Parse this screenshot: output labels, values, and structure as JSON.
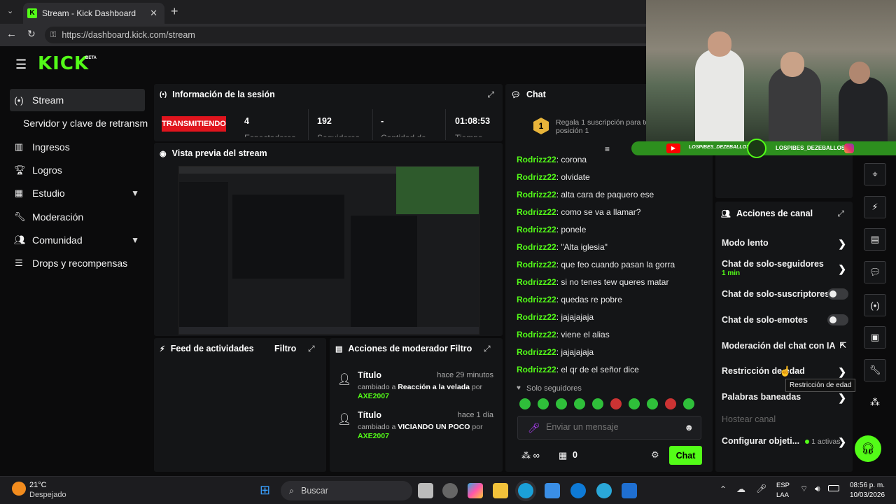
{
  "browser": {
    "tab_title": "Stream - Kick Dashboard",
    "new_tab": "+",
    "url": "https://dashboard.kick.com/stream"
  },
  "logo": {
    "text": "KICK",
    "beta": "BETA"
  },
  "sidebar": {
    "items": [
      {
        "label": "Stream",
        "icon": "broadcast-icon"
      },
      {
        "label": "Servidor y clave de retransm",
        "icon": ""
      },
      {
        "label": "Ingresos",
        "icon": "chart-icon"
      },
      {
        "label": "Logros",
        "icon": "trophy-icon"
      },
      {
        "label": "Estudio",
        "icon": "grid-icon"
      },
      {
        "label": "Moderación",
        "icon": "wrench-icon"
      },
      {
        "label": "Comunidad",
        "icon": "people-icon"
      },
      {
        "label": "Drops y recompensas",
        "icon": "list-icon"
      }
    ]
  },
  "session": {
    "title": "Información de la sesión",
    "status": "TRANSMITIENDO",
    "spectators": "4",
    "spectators_label": "Espectadores",
    "followers": "192",
    "followers_label": "Seguidores",
    "quantity": "-",
    "quantity_label": "Cantidad de",
    "time": "01:08:53",
    "time_label": "Tiempo"
  },
  "preview": {
    "title": "Vista previa del stream"
  },
  "feed": {
    "title": "Feed de actividades",
    "filter": "Filtro"
  },
  "modactions": {
    "title": "Acciones de moderador",
    "filter": "Filtro",
    "entries": [
      {
        "title": "Título",
        "time": "hace 29 minutos",
        "changed": "cambiado a",
        "value": "Reacción a la velada",
        "by": "por",
        "user": "AXE2007"
      },
      {
        "title": "Título",
        "time": "hace 1 día",
        "changed": "cambiado a",
        "value": "VICIANDO UN POCO",
        "by": "por",
        "user": "AXE2007"
      }
    ]
  },
  "chat": {
    "title": "Chat",
    "gift_rank": "1",
    "gift_text": "Regala 1 suscripción para te",
    "gift_text2": "posición 1",
    "messages": [
      {
        "user": "Rodrizz22",
        "text": ": corona"
      },
      {
        "user": "Rodrizz22",
        "text": ": olvidate"
      },
      {
        "user": "Rodrizz22",
        "text": ": alta cara de paquero ese"
      },
      {
        "user": "Rodrizz22",
        "text": ": como se va a llamar?"
      },
      {
        "user": "Rodrizz22",
        "text": ": ponele"
      },
      {
        "user": "Rodrizz22",
        "text": ": \"Alta iglesia\""
      },
      {
        "user": "Rodrizz22",
        "text": ": que feo cuando pasan la gorra"
      },
      {
        "user": "Rodrizz22",
        "text": ": si no tenes tew queres matar"
      },
      {
        "user": "Rodrizz22",
        "text": ": quedas re pobre"
      },
      {
        "user": "Rodrizz22",
        "text": ": jajajajaja"
      },
      {
        "user": "Rodrizz22",
        "text": ": viene el alias"
      },
      {
        "user": "Rodrizz22",
        "text": ": jajajajaja"
      },
      {
        "user": "Rodrizz22",
        "text": ": el qr de el señor dice"
      }
    ],
    "followers_only": "Solo seguidores",
    "placeholder": "Enviar un mensaje",
    "viewer_count": "0",
    "send": "Chat"
  },
  "overlay": {
    "youtube": "LOSPIBES_DEZEBALLOS",
    "instagram": "LOSPIBES_DEZEBALLOS"
  },
  "channel_actions": {
    "title": "Acciones de canal",
    "items": [
      {
        "label": "Modo lento",
        "type": "chevron"
      },
      {
        "label": "Chat de solo-seguidores",
        "sub": "1 min",
        "type": "chevron"
      },
      {
        "label": "Chat de solo-suscriptores",
        "type": "toggle"
      },
      {
        "label": "Chat de solo-emotes",
        "type": "toggle"
      },
      {
        "label": "Moderación del chat con IA",
        "type": "external"
      },
      {
        "label": "Restricción de edad",
        "type": "chevron"
      },
      {
        "label": "Palabras baneadas",
        "type": "chevron"
      },
      {
        "label": "Hostear canal",
        "type": "disabled"
      },
      {
        "label": "Configurar objeti...",
        "sub": "1 activas",
        "type": "chevron"
      }
    ],
    "tooltip": "Restricción de edad"
  },
  "taskbar": {
    "temp": "21°C",
    "weather": "Despejado",
    "search": "Buscar",
    "lang1": "ESP",
    "lang2": "LAA",
    "time": "08:56 p. m.",
    "date": "10/03/2026"
  },
  "colors": {
    "accent": "#53fc18",
    "live": "#e0141d",
    "panel": "#141517"
  }
}
